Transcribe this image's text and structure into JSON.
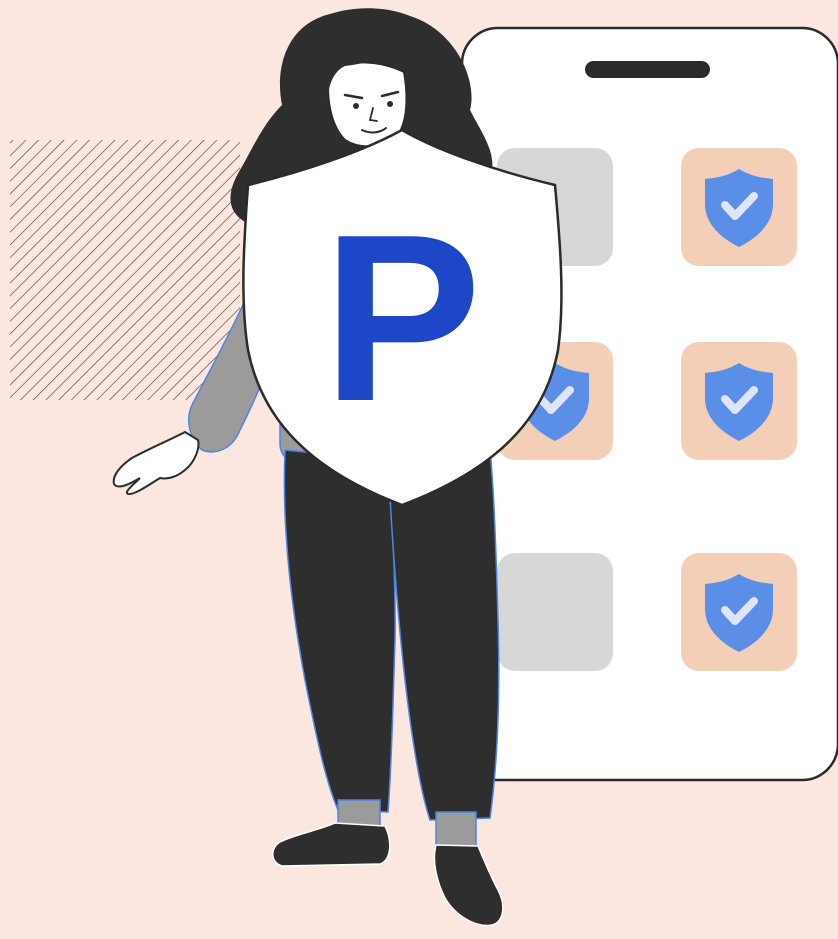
{
  "scene": {
    "background_color": "#fce7e0",
    "accent_blue": "#1e47c7",
    "shield_icon_blue": "#5b8ee6",
    "tile_peach": "#f4cfb8",
    "tile_gray": "#d7d7d7",
    "outline_color": "#2b2b2b"
  },
  "shield": {
    "letter": "P"
  },
  "phone": {
    "tiles": [
      {
        "state": "inactive",
        "icon": "none"
      },
      {
        "state": "protected",
        "icon": "shield-check-icon"
      },
      {
        "state": "protected",
        "icon": "shield-check-icon"
      },
      {
        "state": "protected",
        "icon": "shield-check-icon"
      },
      {
        "state": "inactive",
        "icon": "none"
      },
      {
        "state": "protected",
        "icon": "shield-check-icon"
      }
    ]
  }
}
